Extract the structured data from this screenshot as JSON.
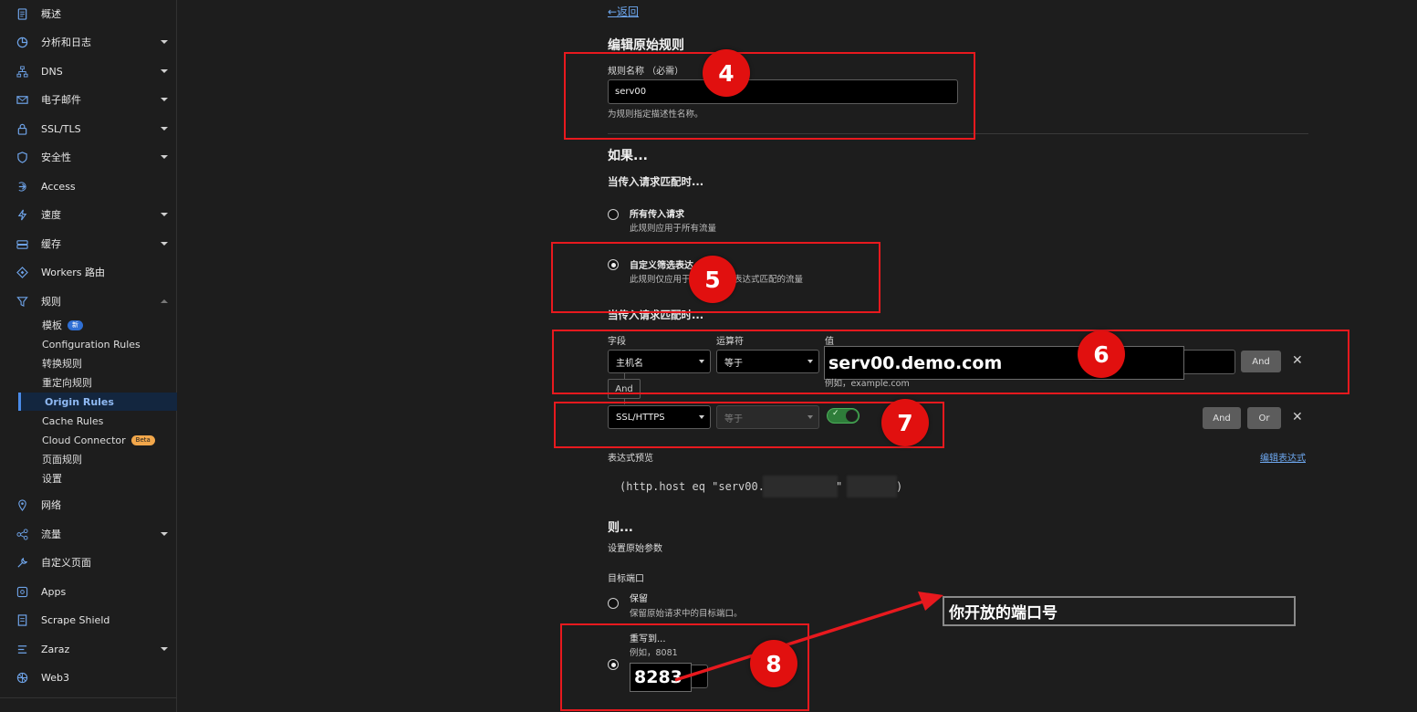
{
  "sidebar": {
    "items": [
      {
        "label": "概述",
        "icon": "document-icon"
      },
      {
        "label": "分析和日志",
        "icon": "chart-icon"
      },
      {
        "label": "DNS",
        "icon": "network-icon"
      },
      {
        "label": "电子邮件",
        "icon": "email-icon"
      },
      {
        "label": "SSL/TLS",
        "icon": "lock-icon"
      },
      {
        "label": "安全性",
        "icon": "shield-icon"
      },
      {
        "label": "Access",
        "icon": "login-icon"
      },
      {
        "label": "速度",
        "icon": "lightning-icon"
      },
      {
        "label": "缓存",
        "icon": "storage-icon"
      },
      {
        "label": "Workers 路由",
        "icon": "workers-icon"
      },
      {
        "label": "规则",
        "icon": "filter-icon"
      },
      {
        "label": "网络",
        "icon": "location-icon"
      },
      {
        "label": "流量",
        "icon": "traffic-icon"
      },
      {
        "label": "自定义页面",
        "icon": "wrench-icon"
      },
      {
        "label": "Apps",
        "icon": "apps-icon"
      },
      {
        "label": "Scrape Shield",
        "icon": "page-icon"
      },
      {
        "label": "Zaraz",
        "icon": "zaraz-icon"
      },
      {
        "label": "Web3",
        "icon": "web3-icon"
      }
    ],
    "rules_sub": {
      "templates": "模板",
      "templates_badge": "新",
      "configuration_rules": "Configuration Rules",
      "transform_rules": "转换规则",
      "redirect_rules": "重定向规则",
      "origin_rules": "Origin Rules",
      "cache_rules": "Cache Rules",
      "cloud_connector": "Cloud Connector",
      "cloud_connector_badge": "Beta",
      "page_rules": "页面规则",
      "settings": "设置"
    }
  },
  "main": {
    "back": "←返回",
    "title": "编辑原始规则",
    "rule_name_label": "规则名称 （必需）",
    "rule_name_value": "serv00",
    "rule_name_hint": "为规则指定描述性名称。",
    "if_heading": "如果...",
    "when_match_heading": "当传入请求匹配时...",
    "all_requests_title": "所有传入请求",
    "all_requests_desc": "此规则应用于所有流量",
    "custom_filter_title": "自定义筛选表达",
    "custom_filter_desc_left": "此规则仅应用于",
    "custom_filter_desc_right": "表达式匹配的流量",
    "when_match_heading2": "当传入请求匹配时...",
    "col_field": "字段",
    "col_operator": "运算符",
    "col_value": "值",
    "row1_field": "主机名",
    "row1_operator": "等于",
    "row1_value": "serv00.demo.com",
    "row1_value_hint": "例如，example.com",
    "and_btn": "And",
    "or_btn": "Or",
    "connector_and": "And",
    "row2_field": "SSL/HTTPS",
    "row2_operator": "等于",
    "toggle_mark": "✓",
    "expr_preview_label": "表达式预览",
    "edit_expression": "编辑表达式",
    "expr_text_a": "(http.host eq \"serv00.",
    "expr_text_b": "\"",
    "expr_text_c": ")",
    "then_heading": "则...",
    "set_origin_params": "设置原始参数",
    "dest_port_label": "目标端口",
    "preserve_title": "保留",
    "preserve_desc": "保留原始请求中的目标端口。",
    "rewrite_title": "重写到...",
    "rewrite_example": "例如，8081",
    "rewrite_value": "8283"
  },
  "annotations": {
    "step4": "4",
    "step5": "5",
    "step6": "6",
    "step7": "7",
    "step8": "8",
    "callout_text": "你开放的端口号",
    "color": "#e8191e"
  },
  "colors": {
    "accent": "#4a8be8",
    "link": "#6ea8f0",
    "toggle_on": "#2e7d3a",
    "annotation_red": "#e8191e"
  }
}
